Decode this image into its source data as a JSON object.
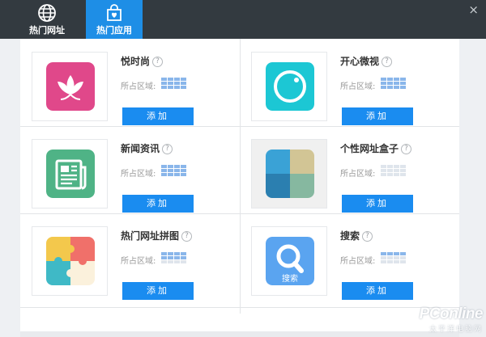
{
  "header": {
    "tabs": [
      {
        "label": "热门网址",
        "icon": "globe-icon",
        "active": false
      },
      {
        "label": "热门应用",
        "icon": "shopping-bag-heart-icon",
        "active": true
      }
    ],
    "close_label": "×"
  },
  "apps": [
    {
      "name": "悦时尚",
      "region_label": "所占区域:",
      "add_label": "添加",
      "icon": "lotus-icon",
      "icon_color": "#e0488a",
      "region_filled_cells": 12
    },
    {
      "name": "开心微视",
      "region_label": "所占区域:",
      "add_label": "添加",
      "icon": "camera-lens-icon",
      "icon_color": "#1cc7d4",
      "region_filled_cells": 12
    },
    {
      "name": "新闻资讯",
      "region_label": "所占区域:",
      "add_label": "添加",
      "icon": "newspaper-icon",
      "icon_color": "#4fb386",
      "region_filled_cells": 12
    },
    {
      "name": "个性网址盒子",
      "region_label": "所占区域:",
      "add_label": "添加",
      "icon": "url-box-tiles-icon",
      "icon_color": "#3aa2d6",
      "region_filled_cells": 0
    },
    {
      "name": "热门网址拼图",
      "region_label": "所占区域:",
      "add_label": "添加",
      "icon": "puzzle-icon",
      "icon_color": "#f3c84c",
      "region_filled_cells": 8
    },
    {
      "name": "搜索",
      "region_label": "所占区域:",
      "add_label": "添加",
      "icon": "search-icon",
      "icon_color": "#5aa4f0",
      "icon_caption": "搜索",
      "region_filled_cells": 4
    }
  ],
  "help_glyph": "?",
  "watermark": {
    "main": "PConline",
    "sub": "太平洋电脑网"
  }
}
